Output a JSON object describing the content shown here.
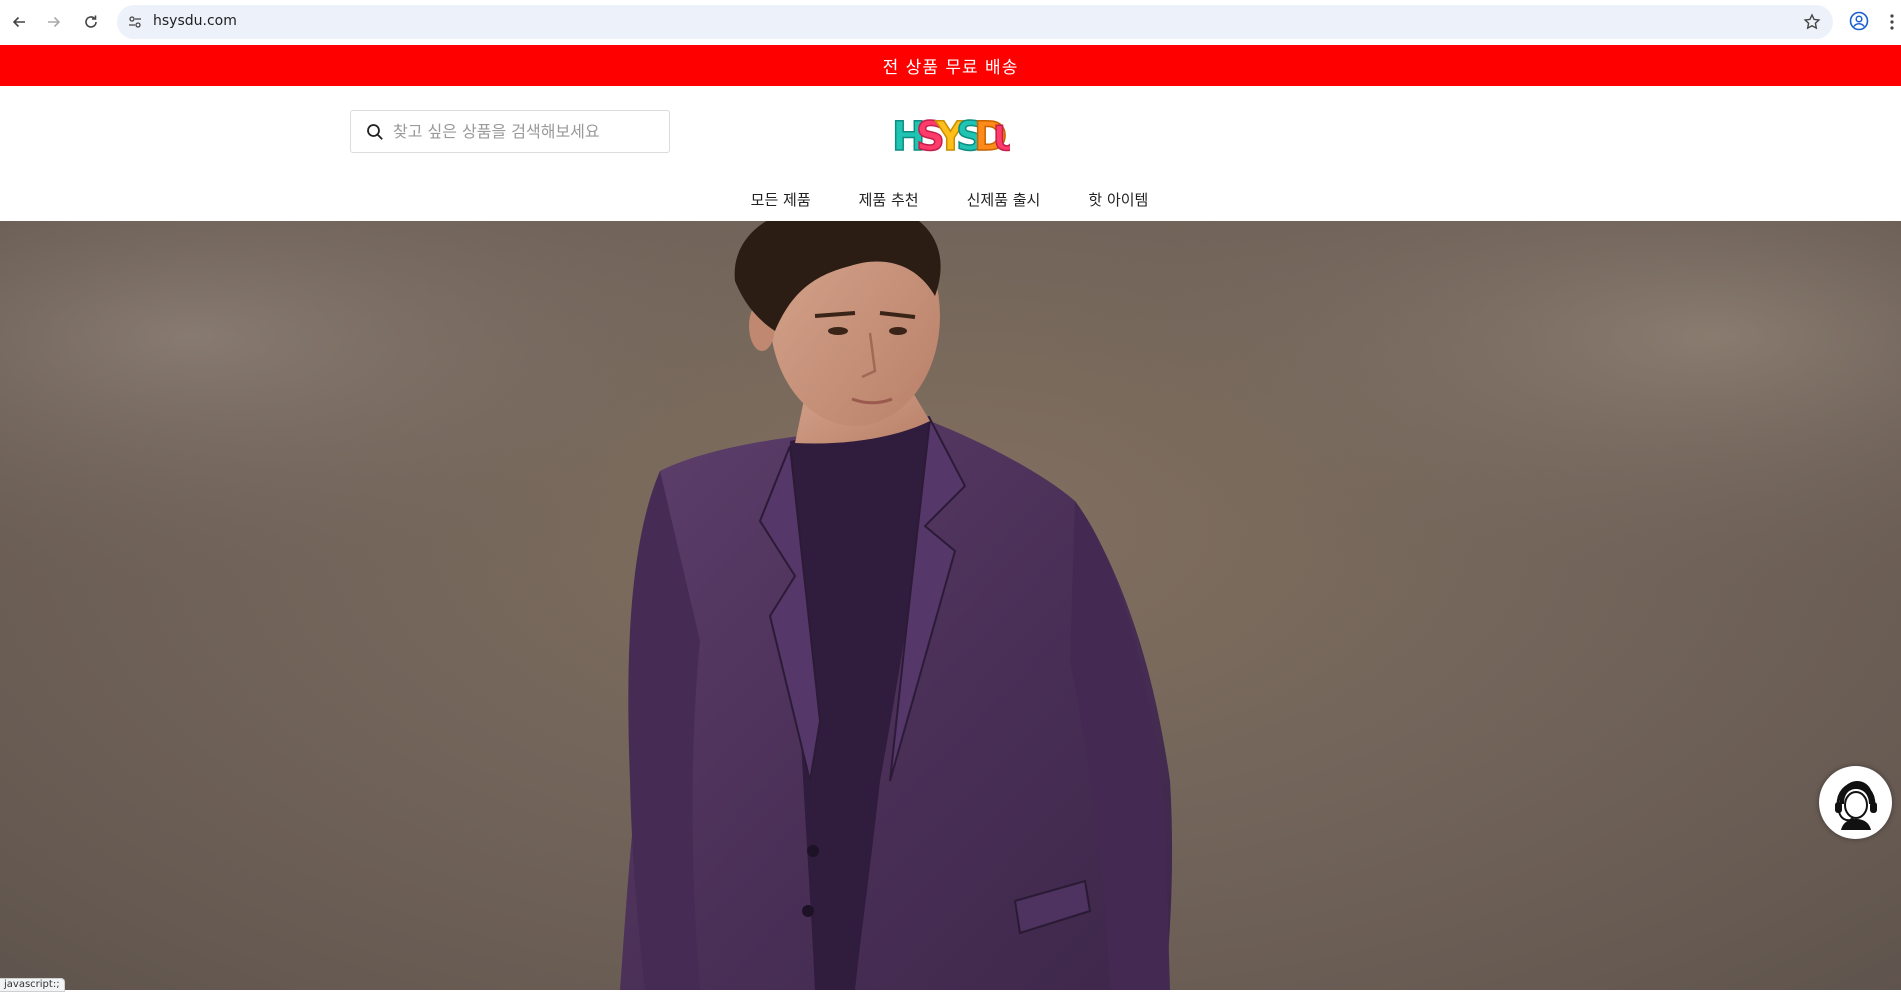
{
  "browser": {
    "url": "hsysdu.com",
    "icons": {
      "back": "arrow-back-icon",
      "forward": "arrow-forward-icon",
      "reload": "reload-icon",
      "site_settings": "tune-icon",
      "bookmark": "star-icon",
      "profile": "account-circle-icon",
      "menu": "kebab-menu-icon"
    }
  },
  "promo_bar": {
    "text": "전 상품 무료 배송",
    "background": "#ff0000"
  },
  "header": {
    "search": {
      "placeholder": "찾고 싶은 상품을 검색해보세요",
      "value": ""
    },
    "logo_text": "HSYSDU",
    "nav": [
      {
        "label": "모든 제품"
      },
      {
        "label": "제품 추천"
      },
      {
        "label": "신제품 출시"
      },
      {
        "label": "핫 아이템"
      }
    ]
  },
  "hero": {
    "image": "man-in-purple-suit-photo"
  },
  "support_button": {
    "icon": "customer-support-headset-icon"
  },
  "status_bar": {
    "text": "javascript:;"
  }
}
